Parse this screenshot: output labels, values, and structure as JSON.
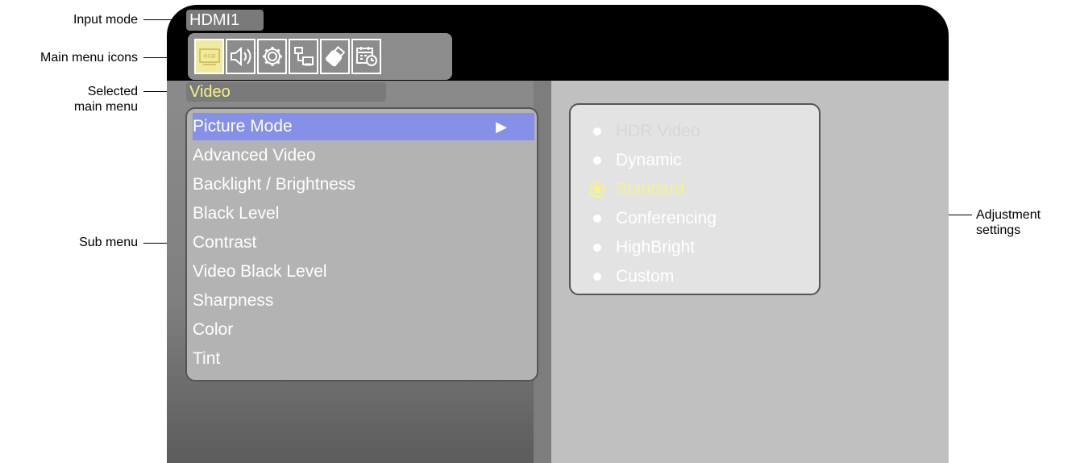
{
  "annotations": {
    "input_mode": "Input mode",
    "main_menu_icons": "Main menu icons",
    "selected_main_menu_line1": "Selected",
    "selected_main_menu_line2": "main menu",
    "sub_menu": "Sub menu",
    "adjustment_line1": "Adjustment",
    "adjustment_line2": "settings"
  },
  "osd": {
    "input_mode": "HDMI1",
    "main_menu_icons": [
      {
        "icon": "rgb-video-icon",
        "label": "RGB",
        "selected": true
      },
      {
        "icon": "speaker-audio-icon",
        "selected": false
      },
      {
        "icon": "gear-setup-icon",
        "selected": false
      },
      {
        "icon": "network-icon",
        "selected": false
      },
      {
        "icon": "usb-stick-icon",
        "selected": false
      },
      {
        "icon": "schedule-calendar-icon",
        "selected": false
      }
    ],
    "selected_main_menu": "Video",
    "sub_menu": [
      "Picture Mode",
      "Advanced Video",
      "Backlight / Brightness",
      "Black Level",
      "Contrast",
      "Video Black Level",
      "Sharpness",
      "Color",
      "Tint"
    ],
    "sub_menu_arrow": "▶",
    "adjustment_options": [
      {
        "label": "HDR Video",
        "state": "disabled"
      },
      {
        "label": "Dynamic",
        "state": "normal"
      },
      {
        "label": "Standard",
        "state": "selected"
      },
      {
        "label": "Conferencing",
        "state": "normal"
      },
      {
        "label": "HighBright",
        "state": "normal"
      },
      {
        "label": "Custom",
        "state": "normal"
      }
    ]
  },
  "colors": {
    "highlight_bar": "#8591e8",
    "selected_text": "#f7f28a",
    "osd_background": "#000000"
  }
}
